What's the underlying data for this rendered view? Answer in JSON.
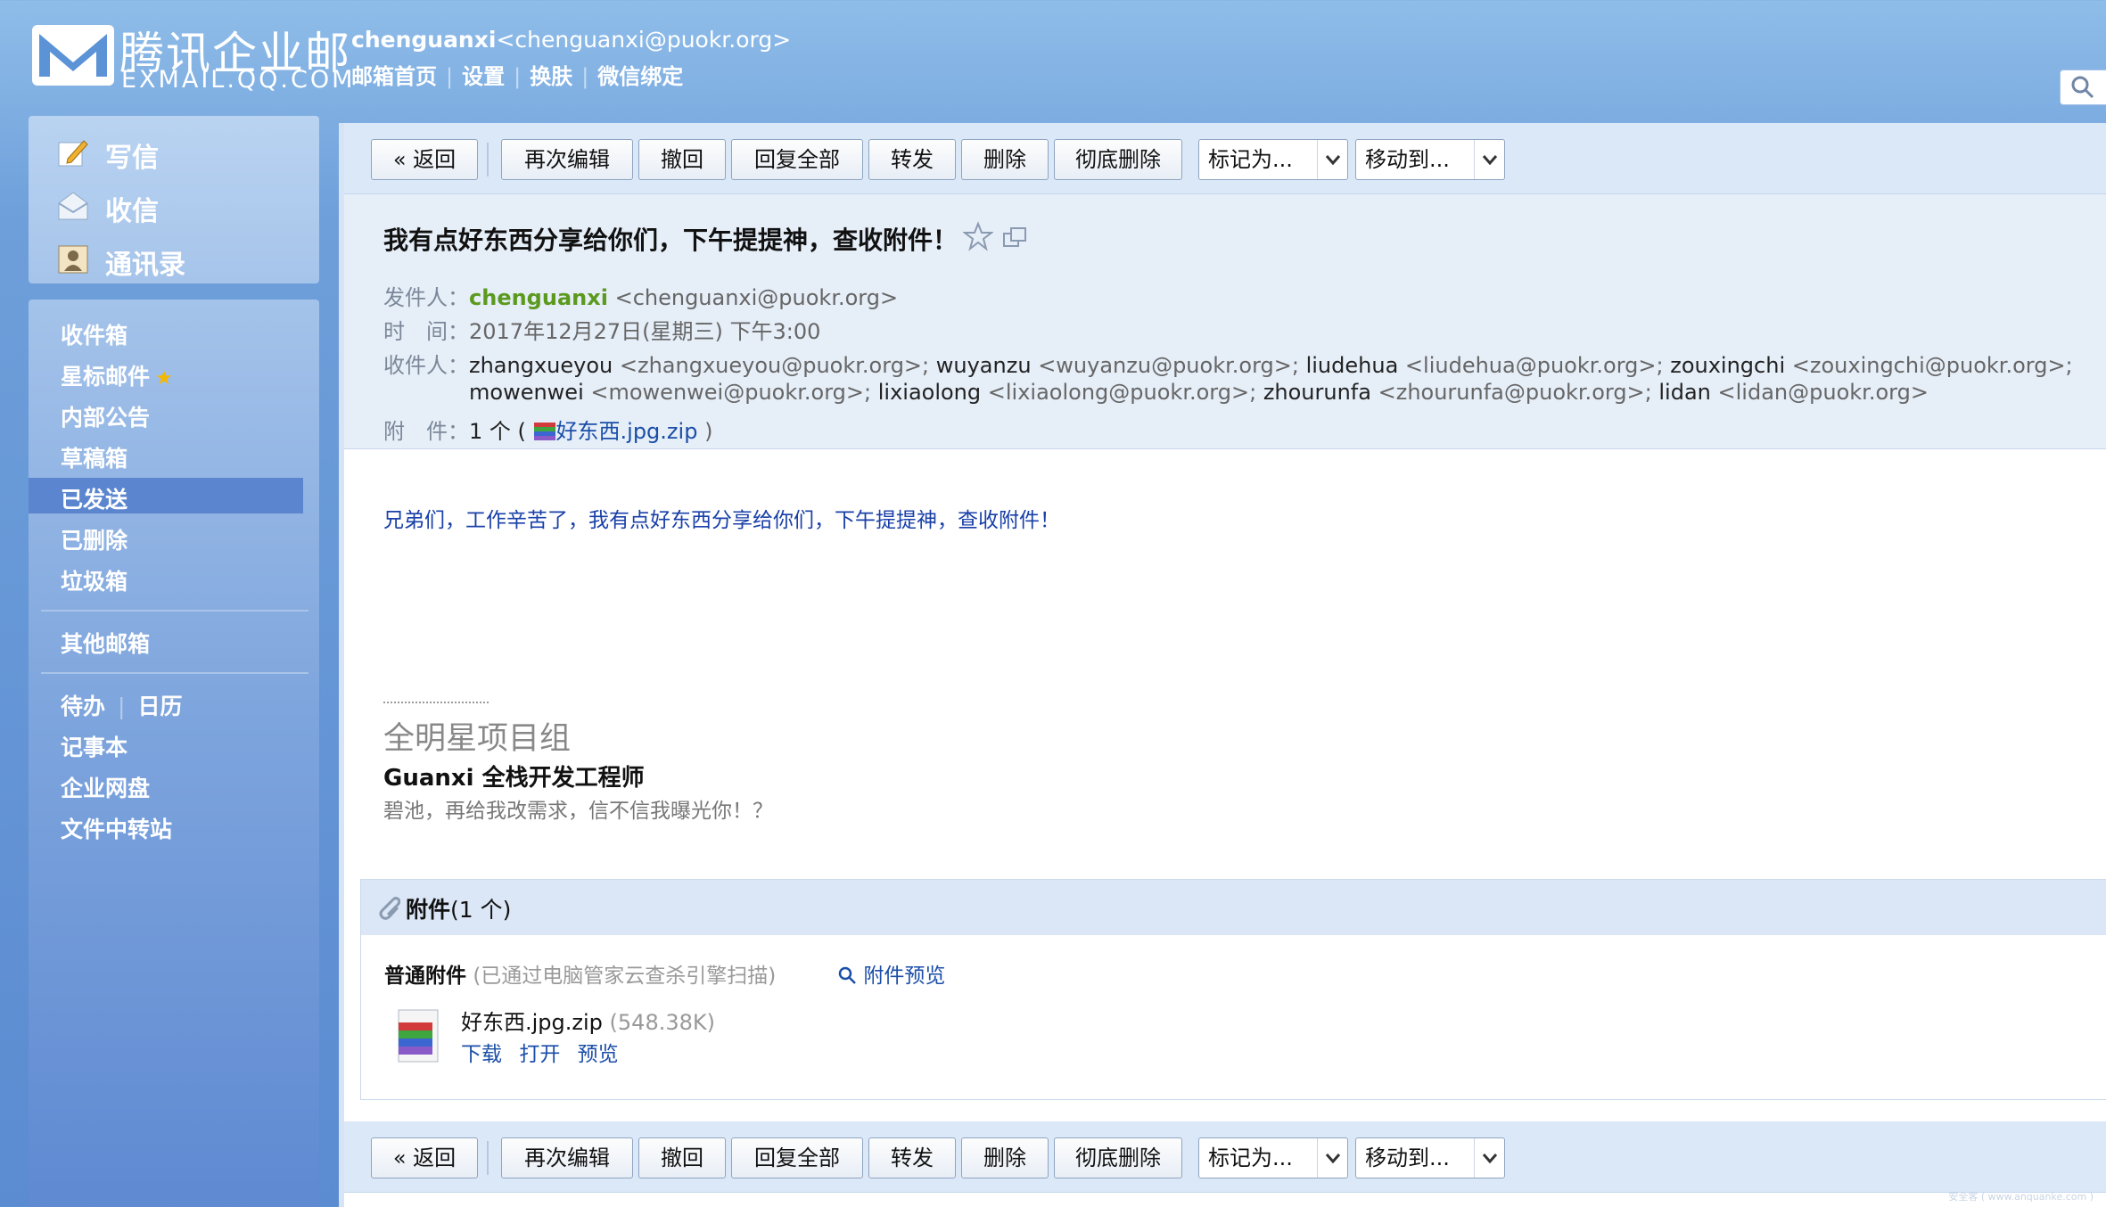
{
  "header": {
    "logo_cn": "腾讯企业邮",
    "logo_en": "EXMAIL.QQ.COM",
    "user_name": "chenguanxi",
    "user_email": "<chenguanxi@puokr.org>",
    "links": [
      "邮箱首页",
      "设置",
      "换肤",
      "微信绑定"
    ]
  },
  "quick_actions": [
    {
      "label": "写信",
      "icon": "compose-icon"
    },
    {
      "label": "收信",
      "icon": "inbox-icon"
    },
    {
      "label": "通讯录",
      "icon": "contacts-icon"
    }
  ],
  "folders": [
    {
      "label": "收件箱"
    },
    {
      "label": "星标邮件"
    },
    {
      "label": "内部公告"
    },
    {
      "label": "草稿箱"
    },
    {
      "label": "已发送"
    },
    {
      "label": "已删除"
    },
    {
      "label": "垃圾箱"
    }
  ],
  "other_mailboxes": "其他邮箱",
  "tools": {
    "todo": "待办",
    "calendar": "日历",
    "notes": "记事本",
    "netdisk": "企业网盘",
    "transfer": "文件中转站"
  },
  "toolbar": {
    "back": "« 返回",
    "reedit": "再次编辑",
    "recall": "撤回",
    "reply_all": "回复全部",
    "forward": "转发",
    "delete": "删除",
    "delete_forever": "彻底删除",
    "mark_as": "标记为...",
    "move_to": "移动到..."
  },
  "mail": {
    "subject": "我有点好东西分享给你们，下午提提神，查收附件！",
    "from_label": "发件人：",
    "from_name": "chenguanxi",
    "from_addr": "<chenguanxi@puokr.org>",
    "time_label": "时　间：",
    "time": "2017年12月27日(星期三) 下午3:00",
    "to_label": "收件人：",
    "recipients": [
      {
        "name": "zhangxueyou",
        "addr": "<zhangxueyou@puokr.org>;"
      },
      {
        "name": "wuyanzu",
        "addr": "<wuyanzu@puokr.org>;"
      },
      {
        "name": "liudehua",
        "addr": "<liudehua@puokr.org>;"
      },
      {
        "name": "zouxingchi",
        "addr": "<zouxingchi@puokr.org>;"
      },
      {
        "name": "mowenwei",
        "addr": "<mowenwei@puokr.org>;"
      },
      {
        "name": "lixiaolong",
        "addr": "<lixiaolong@puokr.org>;"
      },
      {
        "name": "zhourunfa",
        "addr": "<zhourunfa@puokr.org>;"
      },
      {
        "name": "lidan",
        "addr": "<lidan@puokr.org>"
      }
    ],
    "attach_label": "附　件：",
    "attach_count": "1 个 (",
    "attach_name": "好东西.jpg.zip",
    "attach_close": ")",
    "body": "兄弟们，工作辛苦了，我有点好东西分享给你们，下午提提神，查收附件！",
    "sig_dash": "----------------",
    "sig_group": "全明星项目组",
    "sig_title": "Guanxi 全栈开发工程师",
    "sig_slogan": "碧池，再给我改需求，信不信我曝光你！？"
  },
  "attachments": {
    "title": "附件",
    "count": "(1 个)",
    "normal_label": "普通附件",
    "scan_note": "(已通过电脑管家云查杀引擎扫描)",
    "preview_all": "附件预览",
    "file_name": "好东西.jpg.zip",
    "file_size": "(548.38K)",
    "actions": [
      "下载",
      "打开",
      "预览"
    ]
  },
  "footer_note": "安全客 ( www.anquanke.com )",
  "colors": {
    "accent_blue": "#1b4ea8",
    "sender_green": "#5c9a1f",
    "sidebar_active": "#5b86cf"
  }
}
